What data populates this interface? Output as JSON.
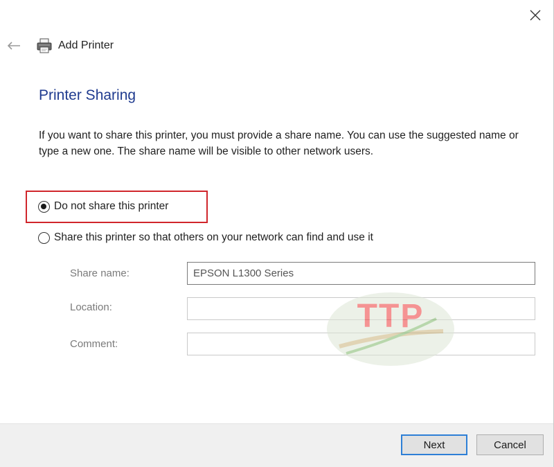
{
  "window": {
    "title": "Add Printer",
    "close_icon": "close-icon",
    "back_icon": "back-arrow-icon",
    "printer_icon": "printer-icon"
  },
  "page": {
    "heading": "Printer Sharing",
    "description": "If you want to share this printer, you must provide a share name. You can use the suggested name or type a new one. The share name will be visible to other network users."
  },
  "options": {
    "do_not_share": {
      "label": "Do not share this printer",
      "checked": true
    },
    "share": {
      "label": "Share this printer so that others on your network can find and use it",
      "checked": false
    }
  },
  "fields": {
    "share_name": {
      "label": "Share name:",
      "value": "EPSON L1300 Series"
    },
    "location": {
      "label": "Location:",
      "value": ""
    },
    "comment": {
      "label": "Comment:",
      "value": ""
    }
  },
  "watermark": {
    "text": "TTP"
  },
  "buttons": {
    "next": "Next",
    "cancel": "Cancel"
  },
  "colors": {
    "heading": "#1f3b8f",
    "highlight": "#d0252b",
    "primary_border": "#2d7fd6"
  }
}
